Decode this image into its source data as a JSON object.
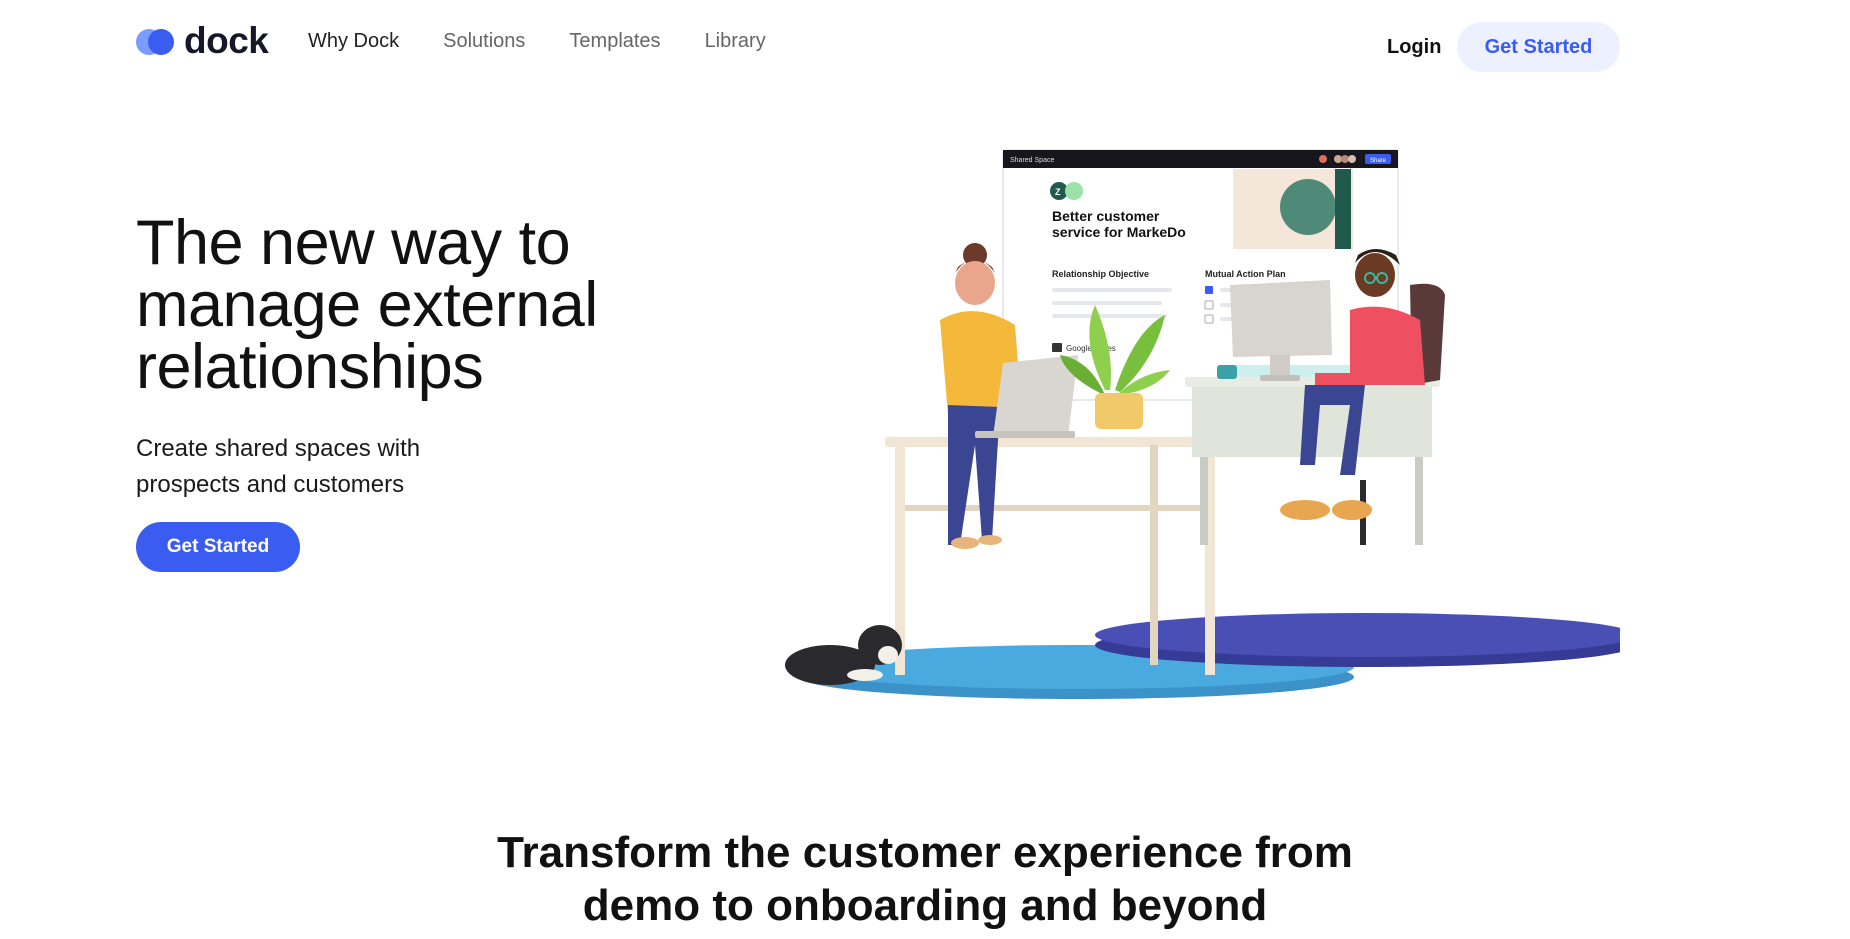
{
  "nav": {
    "logo_text": "dock",
    "links": [
      {
        "label": "Why Dock"
      },
      {
        "label": "Solutions"
      },
      {
        "label": "Templates"
      },
      {
        "label": "Library"
      }
    ],
    "login_label": "Login",
    "cta_label": "Get Started"
  },
  "hero": {
    "title": "The new way to manage external relationships",
    "subtitle": "Create shared spaces with prospects and customers",
    "cta_label": "Get Started"
  },
  "mockup": {
    "window_label": "Shared Space",
    "share_label": "Share",
    "card_title_line1": "Better customer",
    "card_title_line2": "service for MarkeDo",
    "col1_heading": "Relationship Objective",
    "col2_heading": "Mutual Action Plan",
    "attachment_label": "Google Slides",
    "logo_letter": "Z"
  },
  "section": {
    "heading_line1": "Transform the customer experience from",
    "heading_line2": "demo to onboarding and beyond"
  },
  "colors": {
    "brand_blue": "#3b5cf0",
    "brand_light": "#edf1ff",
    "platform_light": "#4aa9de",
    "platform_dark": "#4a4fb5"
  }
}
